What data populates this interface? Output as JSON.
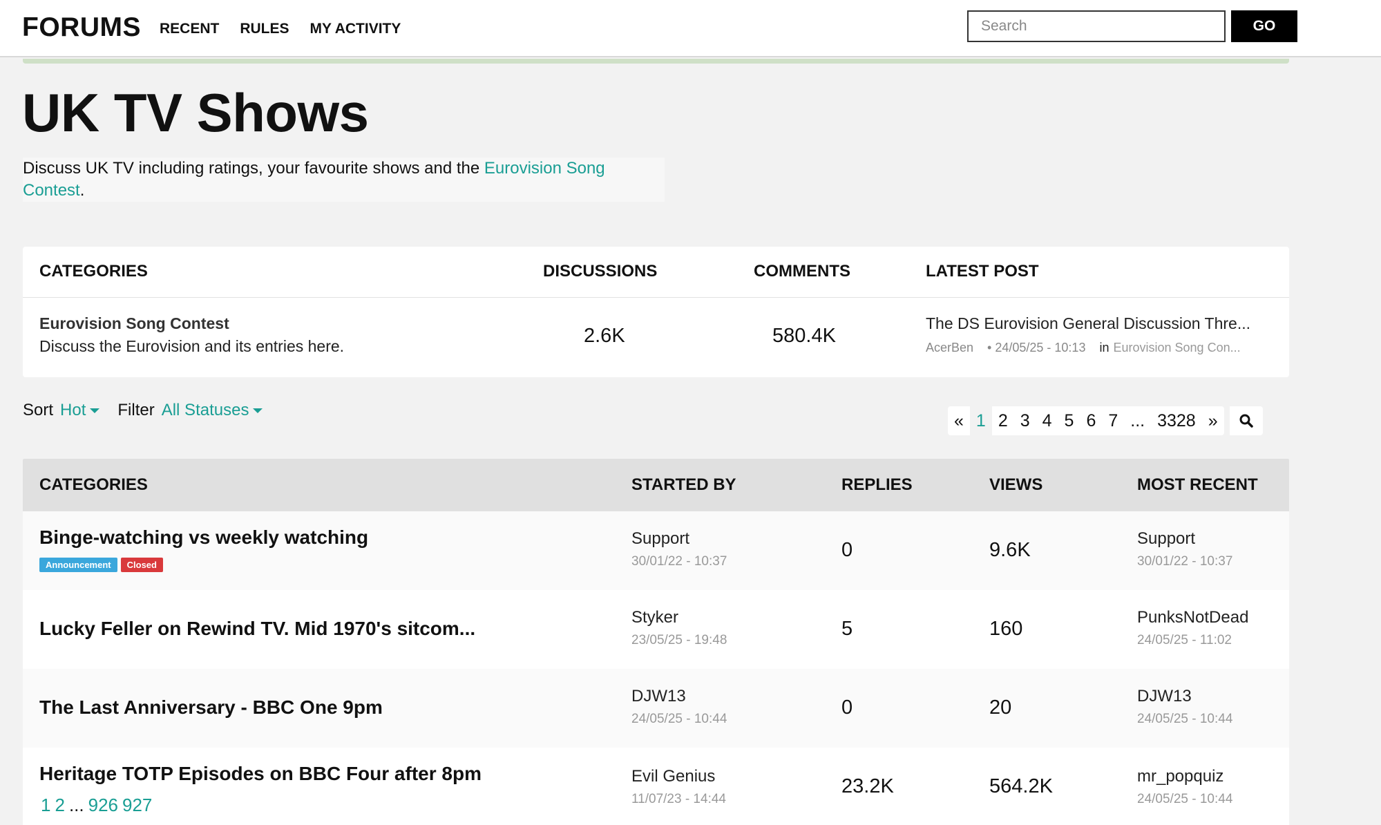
{
  "header": {
    "logo": "FORUMS",
    "nav": [
      "RECENT",
      "RULES",
      "MY ACTIVITY"
    ],
    "search_placeholder": "Search",
    "go_label": "GO"
  },
  "page": {
    "title": "UK TV Shows",
    "description_prefix": "Discuss UK TV including ratings, your favourite shows and the ",
    "description_link": "Eurovision Song Contest",
    "description_suffix": "."
  },
  "categories_table": {
    "headers": {
      "categories": "CATEGORIES",
      "discussions": "DISCUSSIONS",
      "comments": "COMMENTS",
      "latest_post": "LATEST POST"
    },
    "row": {
      "name": "Eurovision Song Contest",
      "description": "Discuss the Eurovision and its entries here.",
      "discussions": "2.6K",
      "comments": "580.4K",
      "latest_title": "The DS Eurovision General Discussion Thre...",
      "latest_user": "AcerBen",
      "latest_date": "• 24/05/25 - 10:13",
      "latest_in": "in",
      "latest_category": "Eurovision Song Con..."
    }
  },
  "controls": {
    "sort_label": "Sort",
    "sort_value": "Hot",
    "filter_label": "Filter",
    "filter_value": "All Statuses"
  },
  "pagination": {
    "prev": "«",
    "pages": [
      "1",
      "2",
      "3",
      "4",
      "5",
      "6",
      "7",
      "...",
      "3328"
    ],
    "current": "1",
    "next": "»",
    "search_icon": "search-icon"
  },
  "discussions_table": {
    "headers": {
      "categories": "CATEGORIES",
      "started_by": "STARTED BY",
      "replies": "REPLIES",
      "views": "VIEWS",
      "most_recent": "MOST RECENT"
    },
    "rows": [
      {
        "title": "Binge-watching vs weekly watching",
        "badges": [
          {
            "label": "Announcement",
            "color": "#3aa7dc"
          },
          {
            "label": "Closed",
            "color": "#d9393b"
          }
        ],
        "started_by": "Support",
        "started_date": "30/01/22 - 10:37",
        "replies": "0",
        "views": "9.6K",
        "recent_user": "Support",
        "recent_date": "30/01/22 - 10:37"
      },
      {
        "title": "Lucky Feller on Rewind TV. Mid 1970's sitcom...",
        "started_by": "Styker",
        "started_date": "23/05/25 - 19:48",
        "replies": "5",
        "views": "160",
        "recent_user": "PunksNotDead",
        "recent_date": "24/05/25 - 11:02"
      },
      {
        "title": "The Last Anniversary - BBC One 9pm",
        "started_by": "DJW13",
        "started_date": "24/05/25 - 10:44",
        "replies": "0",
        "views": "20",
        "recent_user": "DJW13",
        "recent_date": "24/05/25 - 10:44"
      },
      {
        "title": "Heritage TOTP Episodes on BBC Four after 8pm",
        "page_links": [
          "1",
          "2",
          "...",
          "926",
          "927"
        ],
        "started_by": "Evil Genius",
        "started_date": "11/07/23 - 14:44",
        "replies": "23.2K",
        "views": "564.2K",
        "recent_user": "mr_popquiz",
        "recent_date": "24/05/25 - 10:44"
      }
    ]
  },
  "colors": {
    "accent": "#1a9e94",
    "announcement_badge": "#3aa7dc",
    "closed_badge": "#d9393b"
  }
}
